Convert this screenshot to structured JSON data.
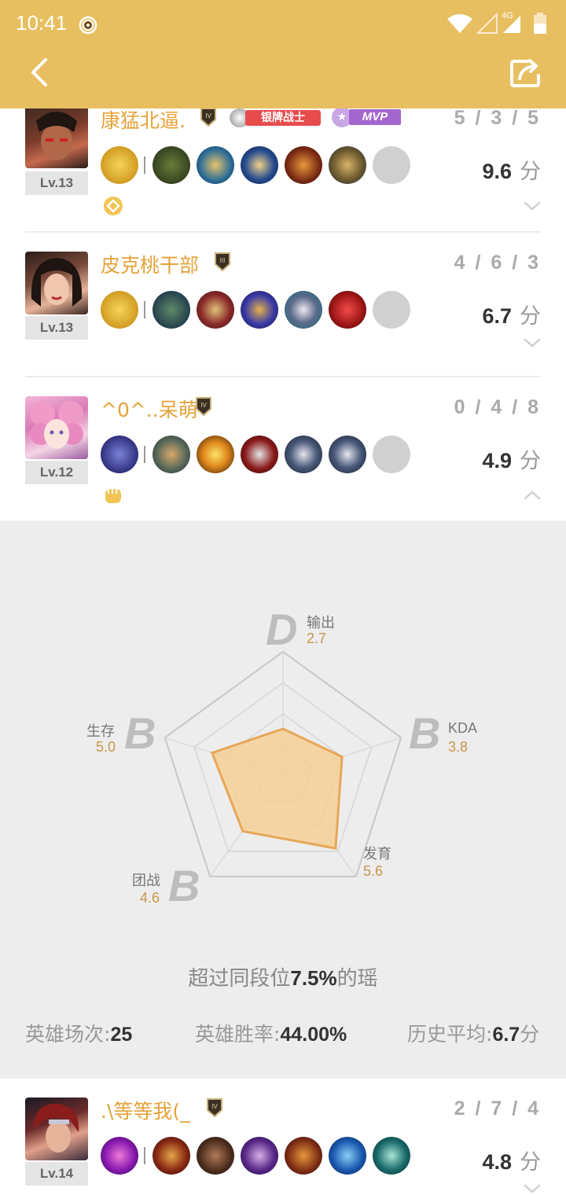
{
  "status_bar": {
    "time": "10:41",
    "network": "4G"
  },
  "header": {
    "back_icon": "chevron-left-icon",
    "share_icon": "share-icon",
    "color": "#e8bf60"
  },
  "players": [
    {
      "name": "康猛北逼.",
      "level": "Lv.13",
      "kda": "5 / 3 / 5",
      "score": "9.6",
      "score_unit": "分",
      "badges": [
        "银牌战士",
        "MVP"
      ],
      "expanded": false
    },
    {
      "name": "皮克桃干部",
      "level": "Lv.13",
      "kda": "4 / 6 / 3",
      "score": "6.7",
      "score_unit": "分",
      "expanded": false
    },
    {
      "name": "^0^..呆萌",
      "level": "Lv.12",
      "kda": "0 / 4 / 8",
      "score": "4.9",
      "score_unit": "分",
      "expanded": true
    },
    {
      "name": ".\\等等我(_",
      "level": "Lv.14",
      "kda": "2 / 7 / 4",
      "score": "4.8",
      "score_unit": "分",
      "expanded": false
    }
  ],
  "radar": {
    "stats": [
      {
        "label": "输出",
        "value": "2.7",
        "grade": "D"
      },
      {
        "label": "KDA",
        "value": "3.8",
        "grade": "B"
      },
      {
        "label": "发育",
        "value": "5.6",
        "grade": ""
      },
      {
        "label": "团战",
        "value": "4.6",
        "grade": "B"
      },
      {
        "label": "生存",
        "value": "5.0",
        "grade": "B"
      }
    ],
    "fill_levels": [
      0.38,
      0.5,
      0.72,
      0.55,
      0.6
    ],
    "fill_color": "#f5cf95",
    "stroke_color": "#e7a758"
  },
  "summary": {
    "prefix": "超过同段位",
    "percent": "7.5%",
    "suffix": "的瑶"
  },
  "bottom_stats": {
    "matches_label": "英雄场次:",
    "matches_value": "25",
    "winrate_label": "英雄胜率:",
    "winrate_value": "44.00%",
    "avg_label": "历史平均:",
    "avg_value": "6.7",
    "avg_unit": "分"
  }
}
